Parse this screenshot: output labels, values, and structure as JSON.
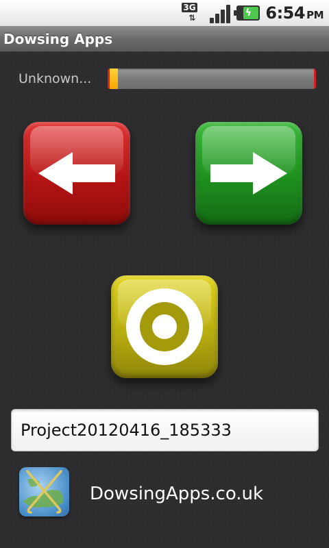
{
  "status_bar": {
    "network_label": "3G",
    "time": "6:54",
    "ampm": "PM"
  },
  "title_bar": {
    "title": "Dowsing Apps"
  },
  "signal": {
    "label": "Unknown...",
    "progress_percent": 5
  },
  "buttons": {
    "left_icon": "arrow-left-icon",
    "right_icon": "arrow-right-icon",
    "target_icon": "target-icon"
  },
  "project": {
    "value": "Project20120416_185333"
  },
  "footer": {
    "link_text": "DowsingApps.co.uk"
  },
  "colors": {
    "left_button": "#c41c1c",
    "right_button": "#2a9a2a",
    "target_button": "#c2b514",
    "progress_fill": "#f5b400"
  }
}
